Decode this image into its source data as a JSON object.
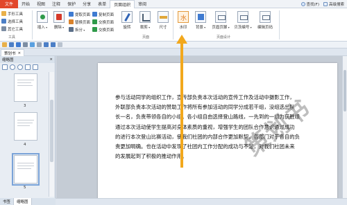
{
  "menu": {
    "tabs": [
      "文件",
      "开始",
      "视图",
      "注释",
      "保护",
      "分享",
      "表单",
      "页面组织",
      "审阅"
    ],
    "active_tab": "页面组织",
    "right": {
      "find": "查找(F)",
      "search": "高级搜索"
    }
  },
  "ribbon": {
    "tools_group": {
      "items": [
        "手形工具",
        "选择工具",
        "其它工具"
      ],
      "label": "工具"
    },
    "insert": "插入",
    "delete": "删除",
    "page_ops": [
      "提取页面",
      "替换页面",
      "拆分",
      "复制页面",
      "交换页面",
      "交换页面"
    ],
    "rotate": "旋转",
    "crop": "裁剪",
    "size": "尺寸",
    "group_label_pages": "页面",
    "watermark": "水印",
    "background": "背景",
    "header_footer": "页眉页脚",
    "bates": "贝茨编号",
    "page_number": "编辑页码",
    "group_label_design": "页面设计"
  },
  "doc_tab": {
    "name": "策划书",
    "close": "×"
  },
  "side_panel": {
    "title": "缩略图",
    "thumb_numbers": [
      "3",
      "4",
      "5"
    ],
    "bottom_tabs": [
      "书签",
      "缩略图"
    ]
  },
  "document": {
    "lines": [
      "参与活动同学的组织工作，宣传部负责本次活动的宣传工作及活动中摄影工作，",
      "外联部负责本次活动的赞助工作将所有参加活动的同学分成若干组，没组选出队",
      "长一名，负责带领各自的小组。各小组自由选择登山路线，一先到的一组为获胜组",
      "通过本次活动使学生提高对身体素质的重视，增强学生的团队合作意识通过成功",
      "的进行本次登山比赛活动，使我们社团的内部合作更加默契，各部门对于各自的负",
      "责更加明确。也在活动中发现了社团内工作分配的成功与不足，对我们社团未来",
      "的发展起到了积极的推动作用。"
    ],
    "watermark": "策划书"
  },
  "colors": {
    "file_tab": "#e2472b",
    "arrow": "#f2a81d"
  }
}
